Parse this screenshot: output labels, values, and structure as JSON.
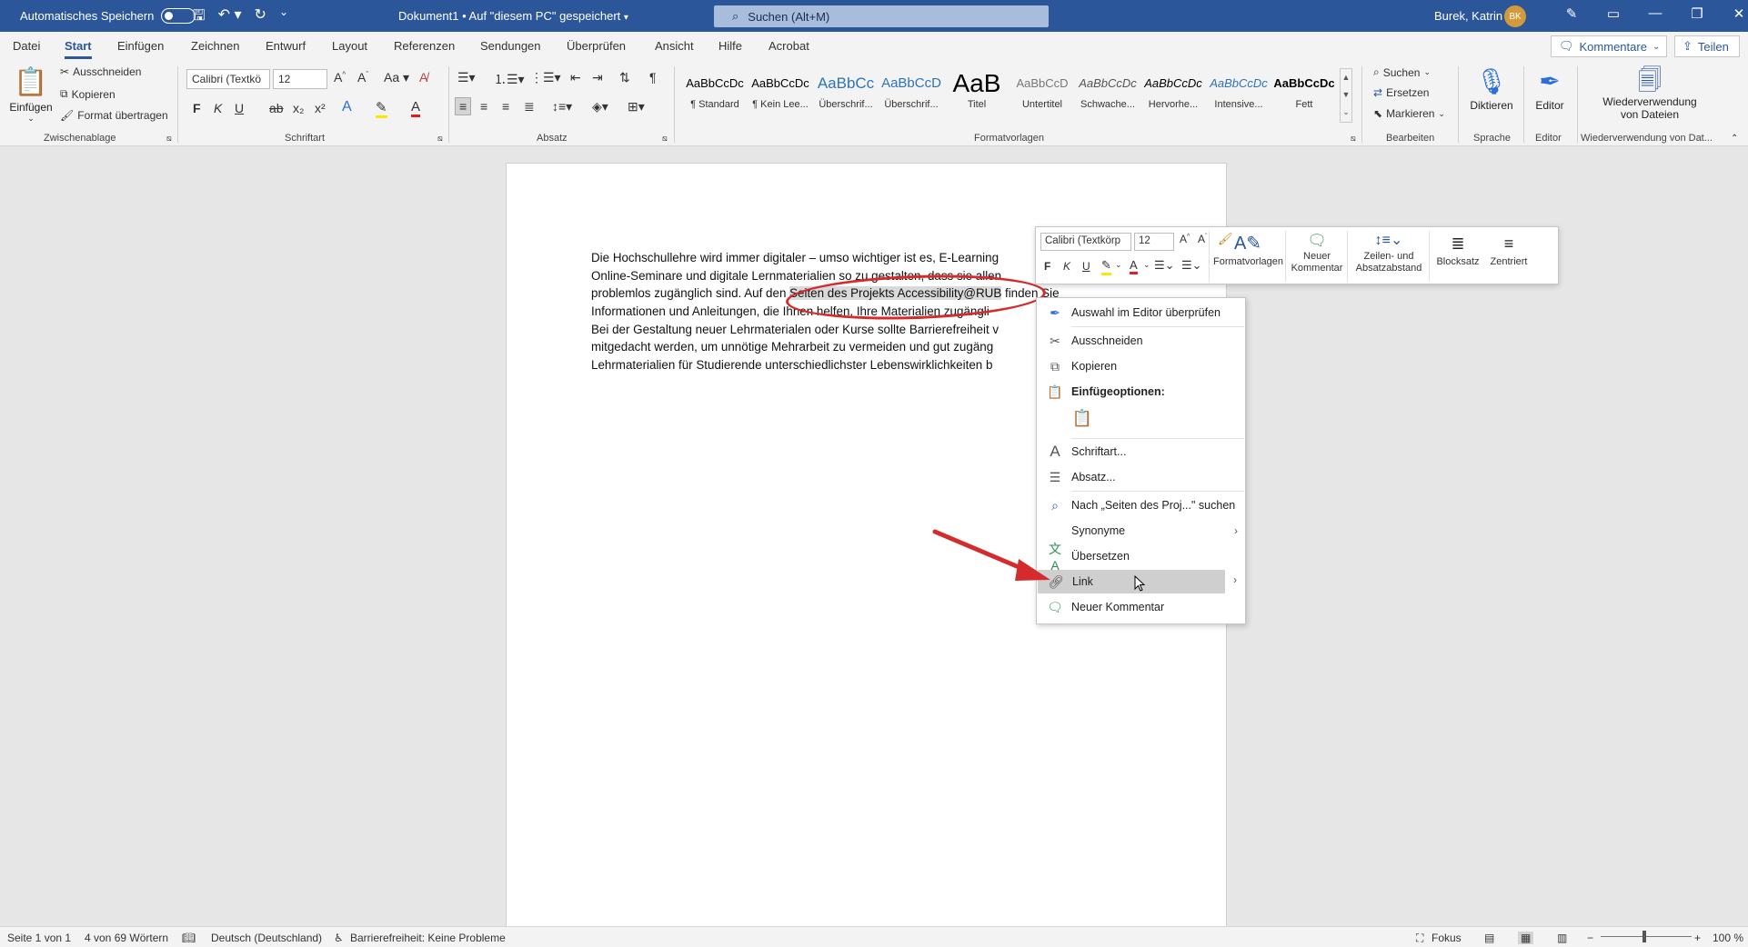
{
  "titlebar": {
    "autosave_label": "Automatisches Speichern",
    "document_title": "Dokument1 • Auf \"diesem PC\" gespeichert",
    "search_placeholder": "Suchen (Alt+M)",
    "user_name": "Burek, Katrin",
    "user_initials": "BK"
  },
  "tabs": [
    "Datei",
    "Start",
    "Einfügen",
    "Zeichnen",
    "Entwurf",
    "Layout",
    "Referenzen",
    "Sendungen",
    "Überprüfen",
    "Ansicht",
    "Hilfe",
    "Acrobat"
  ],
  "active_tab": "Start",
  "header_buttons": {
    "comments": "Kommentare",
    "share": "Teilen"
  },
  "ribbon": {
    "clipboard": {
      "label": "Zwischenablage",
      "paste": "Einfügen",
      "cut": "Ausschneiden",
      "copy": "Kopieren",
      "format_painter": "Format übertragen"
    },
    "font": {
      "label": "Schriftart",
      "font_name": "Calibri (Textkö",
      "font_size": "12",
      "bold": "F",
      "italic": "K",
      "underline": "U",
      "strike": "ab",
      "subscript": "x₂",
      "superscript": "x²",
      "grow": "A^",
      "shrink": "Aˇ",
      "case": "Aa"
    },
    "paragraph": {
      "label": "Absatz"
    },
    "styles": {
      "label": "Formatvorlagen",
      "items": [
        {
          "preview": "AaBbCcDc",
          "name": "¶ Standard"
        },
        {
          "preview": "AaBbCcDc",
          "name": "¶ Kein Lee..."
        },
        {
          "preview": "AaBbCc",
          "name": "Überschrif..."
        },
        {
          "preview": "AaBbCcD",
          "name": "Überschrif..."
        },
        {
          "preview": "AaB",
          "name": "Titel"
        },
        {
          "preview": "AaBbCcD",
          "name": "Untertitel"
        },
        {
          "preview": "AaBbCcDc",
          "name": "Schwache..."
        },
        {
          "preview": "AaBbCcDc",
          "name": "Hervorhe..."
        },
        {
          "preview": "AaBbCcDc",
          "name": "Intensive..."
        },
        {
          "preview": "AaBbCcDc",
          "name": "Fett"
        }
      ]
    },
    "editing": {
      "label": "Bearbeiten",
      "find": "Suchen",
      "replace": "Ersetzen",
      "select": "Markieren"
    },
    "voice": {
      "label": "Sprache",
      "dictate": "Diktieren"
    },
    "editor": {
      "label": "Editor",
      "button": "Editor"
    },
    "reuse": {
      "label": "Wiederverwendung von Dat...",
      "button_line1": "Wiederverwendung",
      "button_line2": "von Dateien"
    }
  },
  "document": {
    "lines": [
      {
        "before": "Die Hochschullehre wird immer digitaler – umso wichtiger ist es, E-Learning",
        "selected": "",
        "after": ""
      },
      {
        "before": "Online-Seminare und digitale Lernmaterialien so zu gestalten, dass sie allen",
        "selected": "",
        "after": ""
      },
      {
        "before": "problemlos zugänglich sind. Auf den ",
        "selected": "Seiten des Projekts Accessibility@RUB",
        "after": " finden Sie"
      },
      {
        "before": "Informationen und Anleitungen, die Ihnen helfen, Ihre Materialien zugängli",
        "selected": "",
        "after": ""
      },
      {
        "before": "Bei der Gestaltung neuer Lehrmaterialen oder Kurse sollte Barrierefreiheit v",
        "selected": "",
        "after": ""
      },
      {
        "before": "mitgedacht werden, um unnötige Mehrarbeit zu vermeiden und gut zugäng",
        "selected": "",
        "after": ""
      },
      {
        "before": "Lehrmaterialien für Studierende unterschiedlichster Lebenswirklichkeiten b",
        "selected": "",
        "after": ""
      }
    ]
  },
  "mini_toolbar": {
    "font_name": "Calibri (Textkörp",
    "font_size": "12",
    "styles": "Formatvorlagen",
    "new_comment_line1": "Neuer",
    "new_comment_line2": "Kommentar",
    "spacing_line1": "Zeilen- und",
    "spacing_line2": "Absatzabstand",
    "justify": "Blocksatz",
    "center": "Zentriert",
    "bold": "F",
    "italic": "K",
    "underline": "U"
  },
  "context_menu": {
    "items": [
      {
        "icon": "editor-pen-icon",
        "label": "Auswahl im Editor überprüfen"
      },
      {
        "icon": "scissors-icon",
        "label": "Ausschneiden"
      },
      {
        "icon": "copy-icon",
        "label": "Kopieren"
      },
      {
        "icon": "clipboard-icon",
        "label": "Einfügeoptionen:"
      },
      {
        "icon": "font-icon",
        "label": "Schriftart..."
      },
      {
        "icon": "paragraph-icon",
        "label": "Absatz..."
      },
      {
        "icon": "search-icon",
        "label": "Nach „Seiten des Proj...\" suchen"
      },
      {
        "icon": "synonyms-icon",
        "label": "Synonyme"
      },
      {
        "icon": "translate-icon",
        "label": "Übersetzen"
      },
      {
        "icon": "link-icon",
        "label": "Link"
      },
      {
        "icon": "comment-icon",
        "label": "Neuer Kommentar"
      }
    ],
    "hovered": "Link"
  },
  "statusbar": {
    "page": "Seite 1 von 1",
    "words": "4 von 69 Wörtern",
    "language": "Deutsch (Deutschland)",
    "accessibility": "Barrierefreiheit: Keine Probleme",
    "focus": "Fokus",
    "zoom": "100 %"
  },
  "colors": {
    "accent": "#2b579a",
    "annotation": "#d42c2c",
    "hover": "#cfcfcf"
  }
}
